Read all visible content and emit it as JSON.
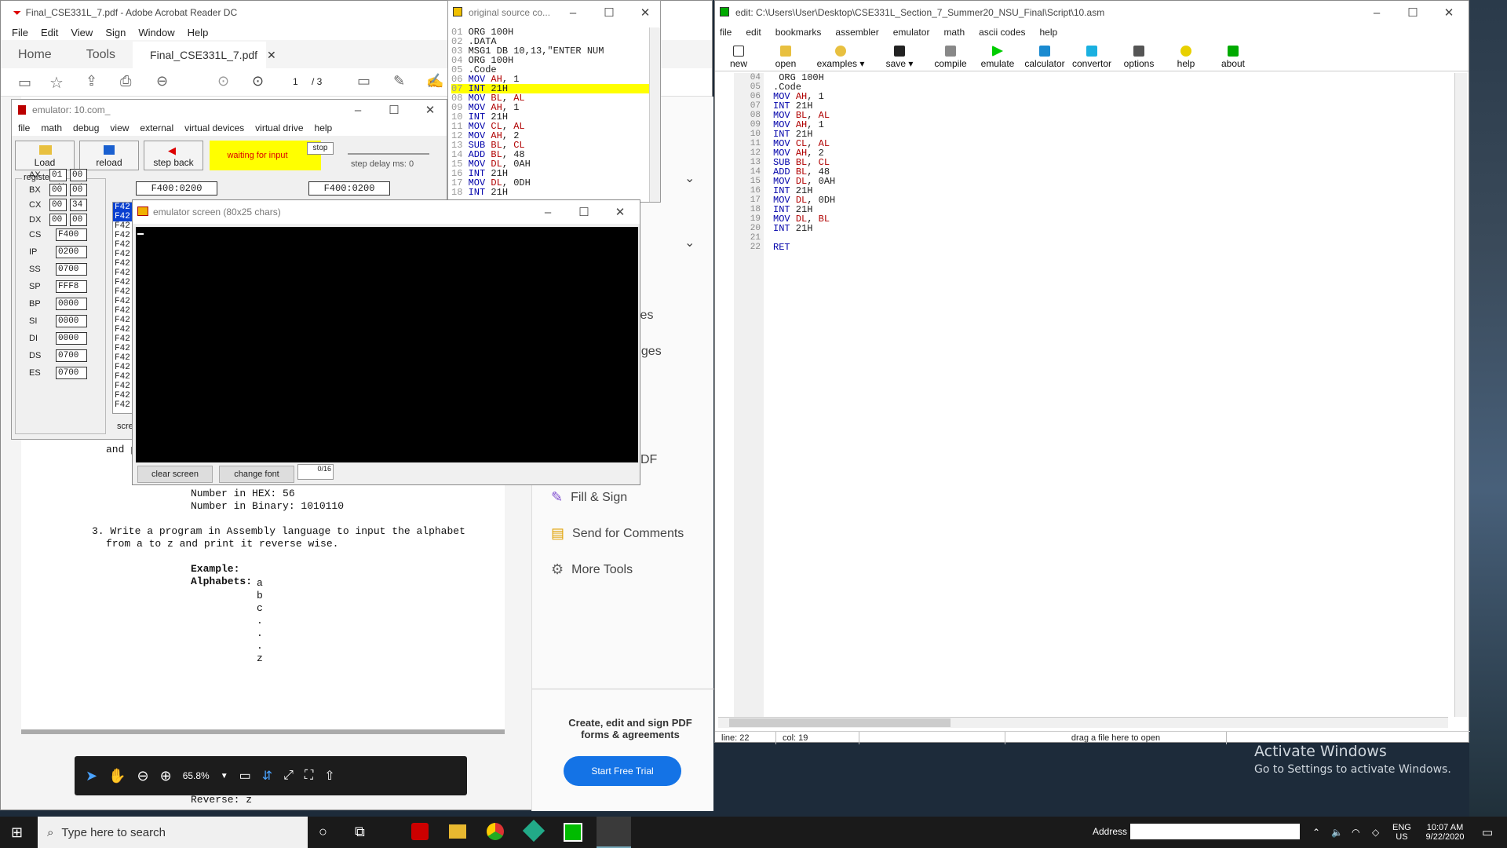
{
  "desktop": {
    "activate_title": "Activate Windows",
    "activate_sub": "Go to Settings to activate Windows."
  },
  "acrobat": {
    "title": "Final_CSE331L_7.pdf - Adobe Acrobat Reader DC",
    "menu": [
      "File",
      "Edit",
      "View",
      "Sign",
      "Window",
      "Help"
    ],
    "tabs": {
      "home": "Home",
      "tools": "Tools",
      "doc": "Final_CSE331L_7.pdf"
    },
    "page_current": "1",
    "page_total": "/ 3",
    "zoom": "65.8%",
    "doc_lines": {
      "and_frag": "and p",
      "hex": "Number in HEX: 56",
      "binary": "Number in Binary: 1010110",
      "q3a": "3. Write a program in Assembly language to input the alphabet",
      "q3b": "from a to z and print it reverse wise.",
      "example": "Example:",
      "alphabets": "Alphabets:",
      "letters": [
        "a",
        "b",
        "c",
        ".",
        ".",
        ".",
        "z"
      ],
      "reverse": "Reverse: z"
    },
    "right_panel": {
      "frag1": "les",
      "frag2": "nges",
      "frag3": "DF",
      "fill_sign": "Fill & Sign",
      "send_comments": "Send for Comments",
      "more_tools": "More Tools",
      "cta": "Create, edit and sign PDF forms & agreements",
      "trial": "Start Free Trial"
    }
  },
  "source": {
    "title": "original source co...",
    "lines": [
      {
        "n": "01",
        "t": "ORG 100H"
      },
      {
        "n": "02",
        "t": ".DATA"
      },
      {
        "n": "03",
        "t": "MSG1 DB 10,13,\"ENTER NUM"
      },
      {
        "n": "04",
        "t": "ORG 100H"
      },
      {
        "n": "05",
        "t": ".Code"
      },
      {
        "n": "06",
        "t": "MOV AH, 1"
      },
      {
        "n": "07",
        "t": "INT 21H"
      },
      {
        "n": "08",
        "t": "MOV BL, AL"
      },
      {
        "n": "09",
        "t": "MOV AH, 1"
      },
      {
        "n": "10",
        "t": "INT 21H"
      },
      {
        "n": "11",
        "t": "MOV CL, AL"
      },
      {
        "n": "12",
        "t": "MOV AH, 2"
      },
      {
        "n": "13",
        "t": "SUB BL, CL"
      },
      {
        "n": "14",
        "t": "ADD BL, 48"
      },
      {
        "n": "15",
        "t": "MOV DL, 0AH"
      },
      {
        "n": "16",
        "t": "INT 21H"
      },
      {
        "n": "17",
        "t": "MOV DL, 0DH"
      },
      {
        "n": "18",
        "t": "INT 21H"
      }
    ]
  },
  "editor": {
    "title": "edit: C:\\Users\\User\\Desktop\\CSE331L_Section_7_Summer20_NSU_Final\\Script\\10.asm",
    "menu": [
      "file",
      "edit",
      "bookmarks",
      "assembler",
      "emulator",
      "math",
      "ascii codes",
      "help"
    ],
    "toolbar": [
      "new",
      "open",
      "examples",
      "save",
      "compile",
      "emulate",
      "calculator",
      "convertor",
      "options",
      "help",
      "about"
    ],
    "lines": [
      {
        "n": "04",
        "t": " ORG 100H"
      },
      {
        "n": "05",
        "t": ".Code"
      },
      {
        "n": "06",
        "t": "MOV AH, 1"
      },
      {
        "n": "07",
        "t": "INT 21H"
      },
      {
        "n": "08",
        "t": "MOV BL, AL"
      },
      {
        "n": "09",
        "t": "MOV AH, 1"
      },
      {
        "n": "10",
        "t": "INT 21H"
      },
      {
        "n": "11",
        "t": "MOV CL, AL"
      },
      {
        "n": "12",
        "t": "MOV AH, 2"
      },
      {
        "n": "13",
        "t": "SUB BL, CL"
      },
      {
        "n": "14",
        "t": "ADD BL, 48"
      },
      {
        "n": "15",
        "t": "MOV DL, 0AH"
      },
      {
        "n": "16",
        "t": "INT 21H"
      },
      {
        "n": "17",
        "t": "MOV DL, 0DH"
      },
      {
        "n": "18",
        "t": "INT 21H"
      },
      {
        "n": "19",
        "t": "MOV DL, BL"
      },
      {
        "n": "20",
        "t": "INT 21H"
      },
      {
        "n": "21",
        "t": ""
      },
      {
        "n": "22",
        "t": "RET"
      }
    ],
    "status_line": "line: 22",
    "status_col": "col: 19",
    "status_drag": "drag a file here to open"
  },
  "emulator": {
    "title": "emulator: 10.com_",
    "menu": [
      "file",
      "math",
      "debug",
      "view",
      "external",
      "virtual devices",
      "virtual drive",
      "help"
    ],
    "load": "Load",
    "reload": "reload",
    "step_back": "step back",
    "waiting": "waiting for input",
    "stop": "stop",
    "step_delay": "step delay ms: 0",
    "addr1": "F400:0200",
    "addr2": "F400:0200",
    "registers_label": "registers",
    "h": "H",
    "l": "L",
    "regs8": [
      {
        "name": "AX",
        "h": "01",
        "l": "00"
      },
      {
        "name": "BX",
        "h": "00",
        "l": "00"
      },
      {
        "name": "CX",
        "h": "00",
        "l": "34"
      },
      {
        "name": "DX",
        "h": "00",
        "l": "00"
      }
    ],
    "regs16": [
      {
        "name": "CS",
        "v": "F400"
      },
      {
        "name": "IP",
        "v": "0200"
      },
      {
        "name": "SS",
        "v": "0700"
      },
      {
        "name": "SP",
        "v": "FFF8"
      },
      {
        "name": "BP",
        "v": "0000"
      },
      {
        "name": "SI",
        "v": "0000"
      },
      {
        "name": "DI",
        "v": "0000"
      },
      {
        "name": "DS",
        "v": "0700"
      },
      {
        "name": "ES",
        "v": "0700"
      }
    ],
    "mem_prefix": "F42",
    "scre": "scre"
  },
  "emuscreen": {
    "title": "emulator screen (80x25 chars)",
    "clear": "clear screen",
    "font": "change font",
    "counter": "0/16"
  },
  "taskbar": {
    "search": "Type here to search",
    "address": "Address",
    "lang1": "ENG",
    "lang2": "US",
    "time": "10:07 AM",
    "date": "9/22/2020"
  }
}
